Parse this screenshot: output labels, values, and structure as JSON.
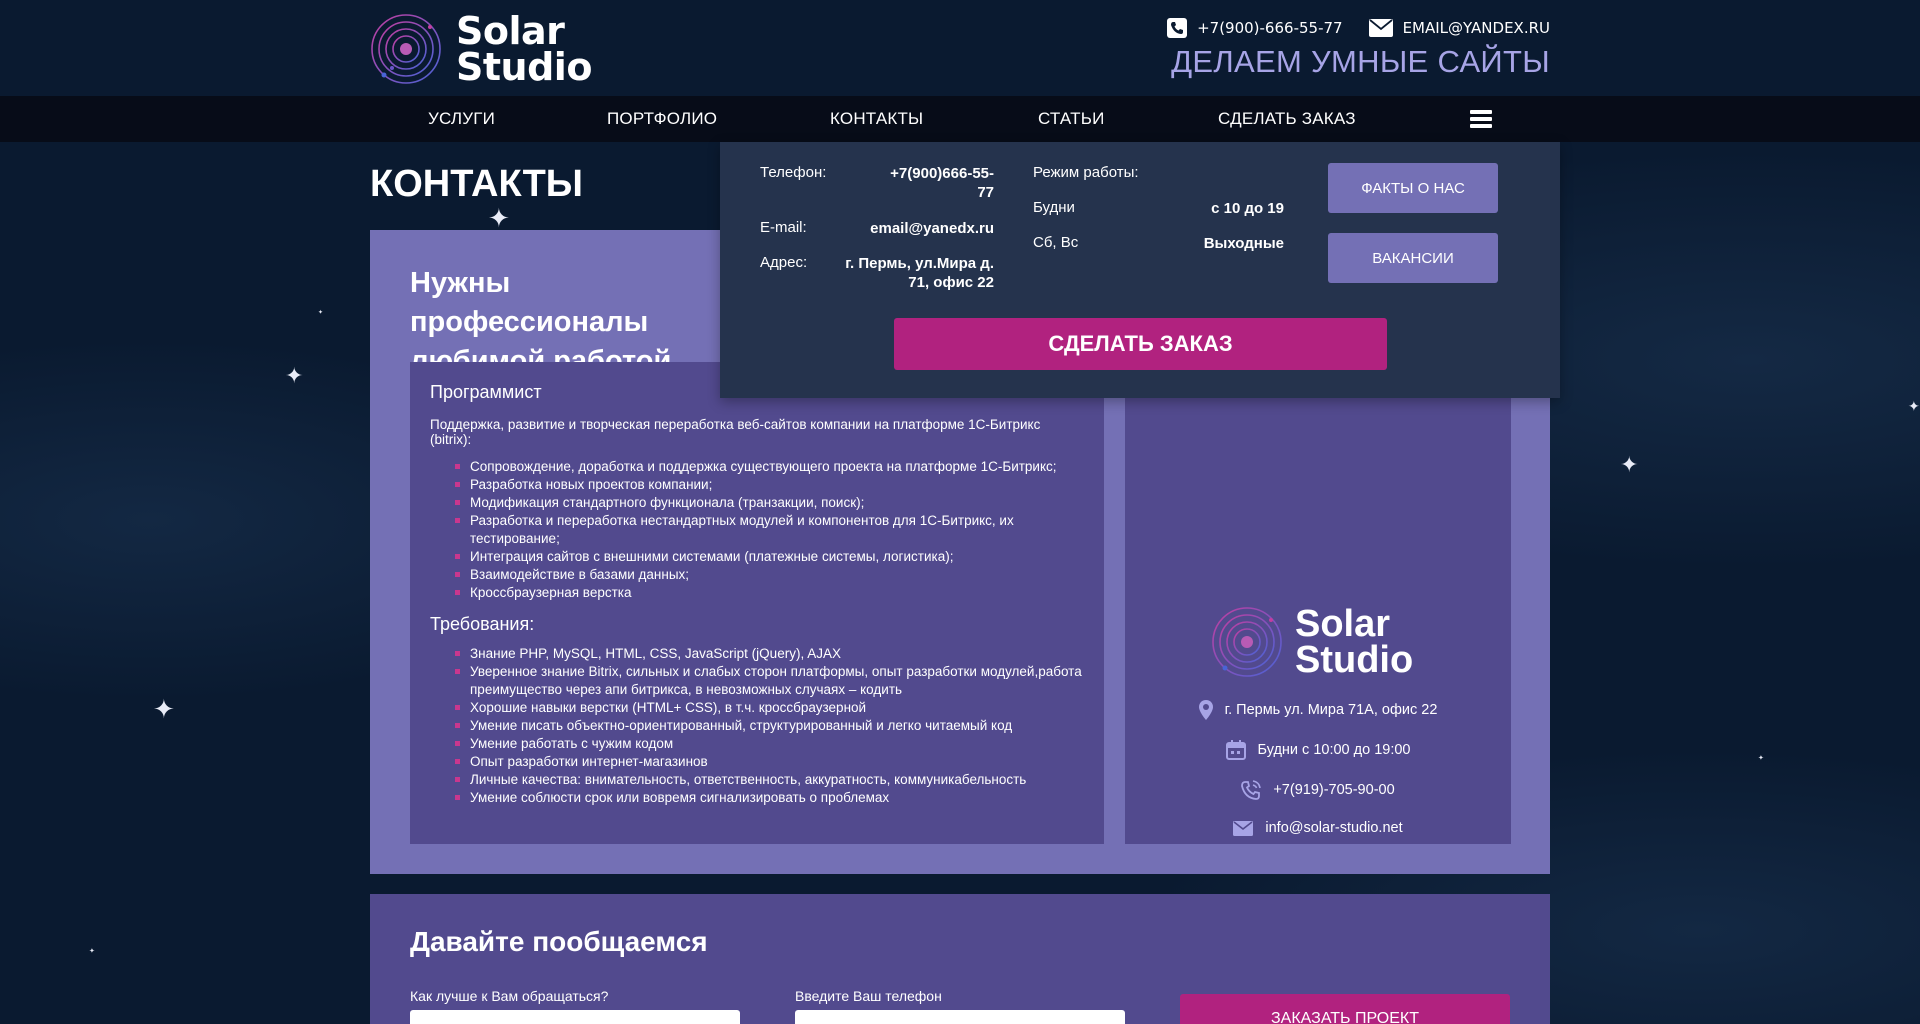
{
  "header": {
    "logo_text_line1": "Solar",
    "logo_text_line2": "Studio",
    "phone": "+7(900)-666-55-77",
    "email": "EMAIL@YANDEX.RU",
    "tagline": "ДЕЛАЕМ УМНЫЕ САЙТЫ",
    "icons": [
      "logo-orbit-icon",
      "phone-icon",
      "mail-icon"
    ]
  },
  "nav": {
    "items": [
      {
        "label": "УСЛУГИ"
      },
      {
        "label": "ПОРТФОЛИО"
      },
      {
        "label": "КОНТАКТЫ"
      },
      {
        "label": "СТАТЬИ"
      },
      {
        "label": "СДЕЛАТЬ ЗАКАЗ"
      }
    ],
    "menu_icon": "hamburger-icon"
  },
  "page": {
    "title": "КОНТАКТЫ",
    "panel_title_line1": "Нужны профессионалы",
    "panel_title_line2": "любимой работой"
  },
  "dropdown": {
    "phone_label": "Телефон:",
    "phone_value_line1": "+7(900)666-55-",
    "phone_value_line2": "77",
    "email_label": "E-mail:",
    "email_value": "email@yanedx.ru",
    "address_label": "Адрес:",
    "address_value_line1": "г. Пермь, ул.Мира д.",
    "address_value_line2": "71, офис 22",
    "hours_label": "Режим работы:",
    "weekdays_label": "Будни",
    "weekdays_value": "с 10 до 19",
    "weekend_label": "Сб, Вс",
    "weekend_value": "Выходные",
    "facts_button": "ФАКТЫ О НАС",
    "vacancies_button": "ВАКАНСИИ",
    "order_button": "СДЕЛАТЬ ЗАКАЗ"
  },
  "job": {
    "title": "Программист",
    "intro": "Поддержка, развитие и творческая переработка веб-сайтов компании на платформе 1С-Битрикс (bitrix):",
    "duties": [
      "Сопровождение, доработка и поддержка существующего проекта на платформе 1С-Битрикс;",
      "Разработка новых проектов компании;",
      "Модификация стандартного функционала (транзакции, поиск);",
      "Разработка и переработка нестандартных модулей и компонентов для 1С-Битрикс, их тестирование;",
      "Интеграция сайтов с внешними системами (платежные системы, логистика);",
      "Взаимодейcтвие в базами данных;",
      "Кроссбраузерная верстка"
    ],
    "requirements_title": "Требования:",
    "requirements": [
      "Знание PHP, MySQL, HTML, CSS, JavaScript (jQuery), AJAX",
      "Уверенное знание Bitrix, сильных и слабых сторон платформы, опыт разработки модулей,работа преимущество через апи битрикса, в невозможных случаях – кодить",
      "Хорошие навыки верстки (HTML+ CSS), в т.ч. кроссбраузерной",
      "Умение писать объектно-ориентированный, структурированный и легко читаемый код",
      "Умение работать с чужим кодом",
      "Опыт разработки интернет-магазинов",
      "Личные качества: внимательность, ответственность, аккуратность, коммуникабельность",
      "Умение соблюсти срок или вовремя сигнализировать о проблемах"
    ]
  },
  "card": {
    "logo_line1": "Solar",
    "logo_line2": "Studio",
    "address": "г. Пермь ул. Мира 71А, офис 22",
    "hours": "Будни с 10:00 до 19:00",
    "phone": "+7(919)-705-90-00",
    "email": "info@solar-studio.net",
    "icons": [
      "location-pin-icon",
      "calendar-icon",
      "phone-ringing-icon",
      "envelope-icon"
    ]
  },
  "form": {
    "title": "Давайте пообщаемся",
    "name_label": "Как лучше к Вам обращаться?",
    "phone_label": "Введите Ваш телефон",
    "submit": "ЗАКАЗАТЬ ПРОЕКТ"
  },
  "colors": {
    "background": "#0a1a30",
    "nav": "#070c18",
    "panel": "#7470b5",
    "panel_inner": "#524a8e",
    "dropdown": "#25334d",
    "accent_magenta": "#b1227f",
    "tagline": "#a7a4e6"
  }
}
